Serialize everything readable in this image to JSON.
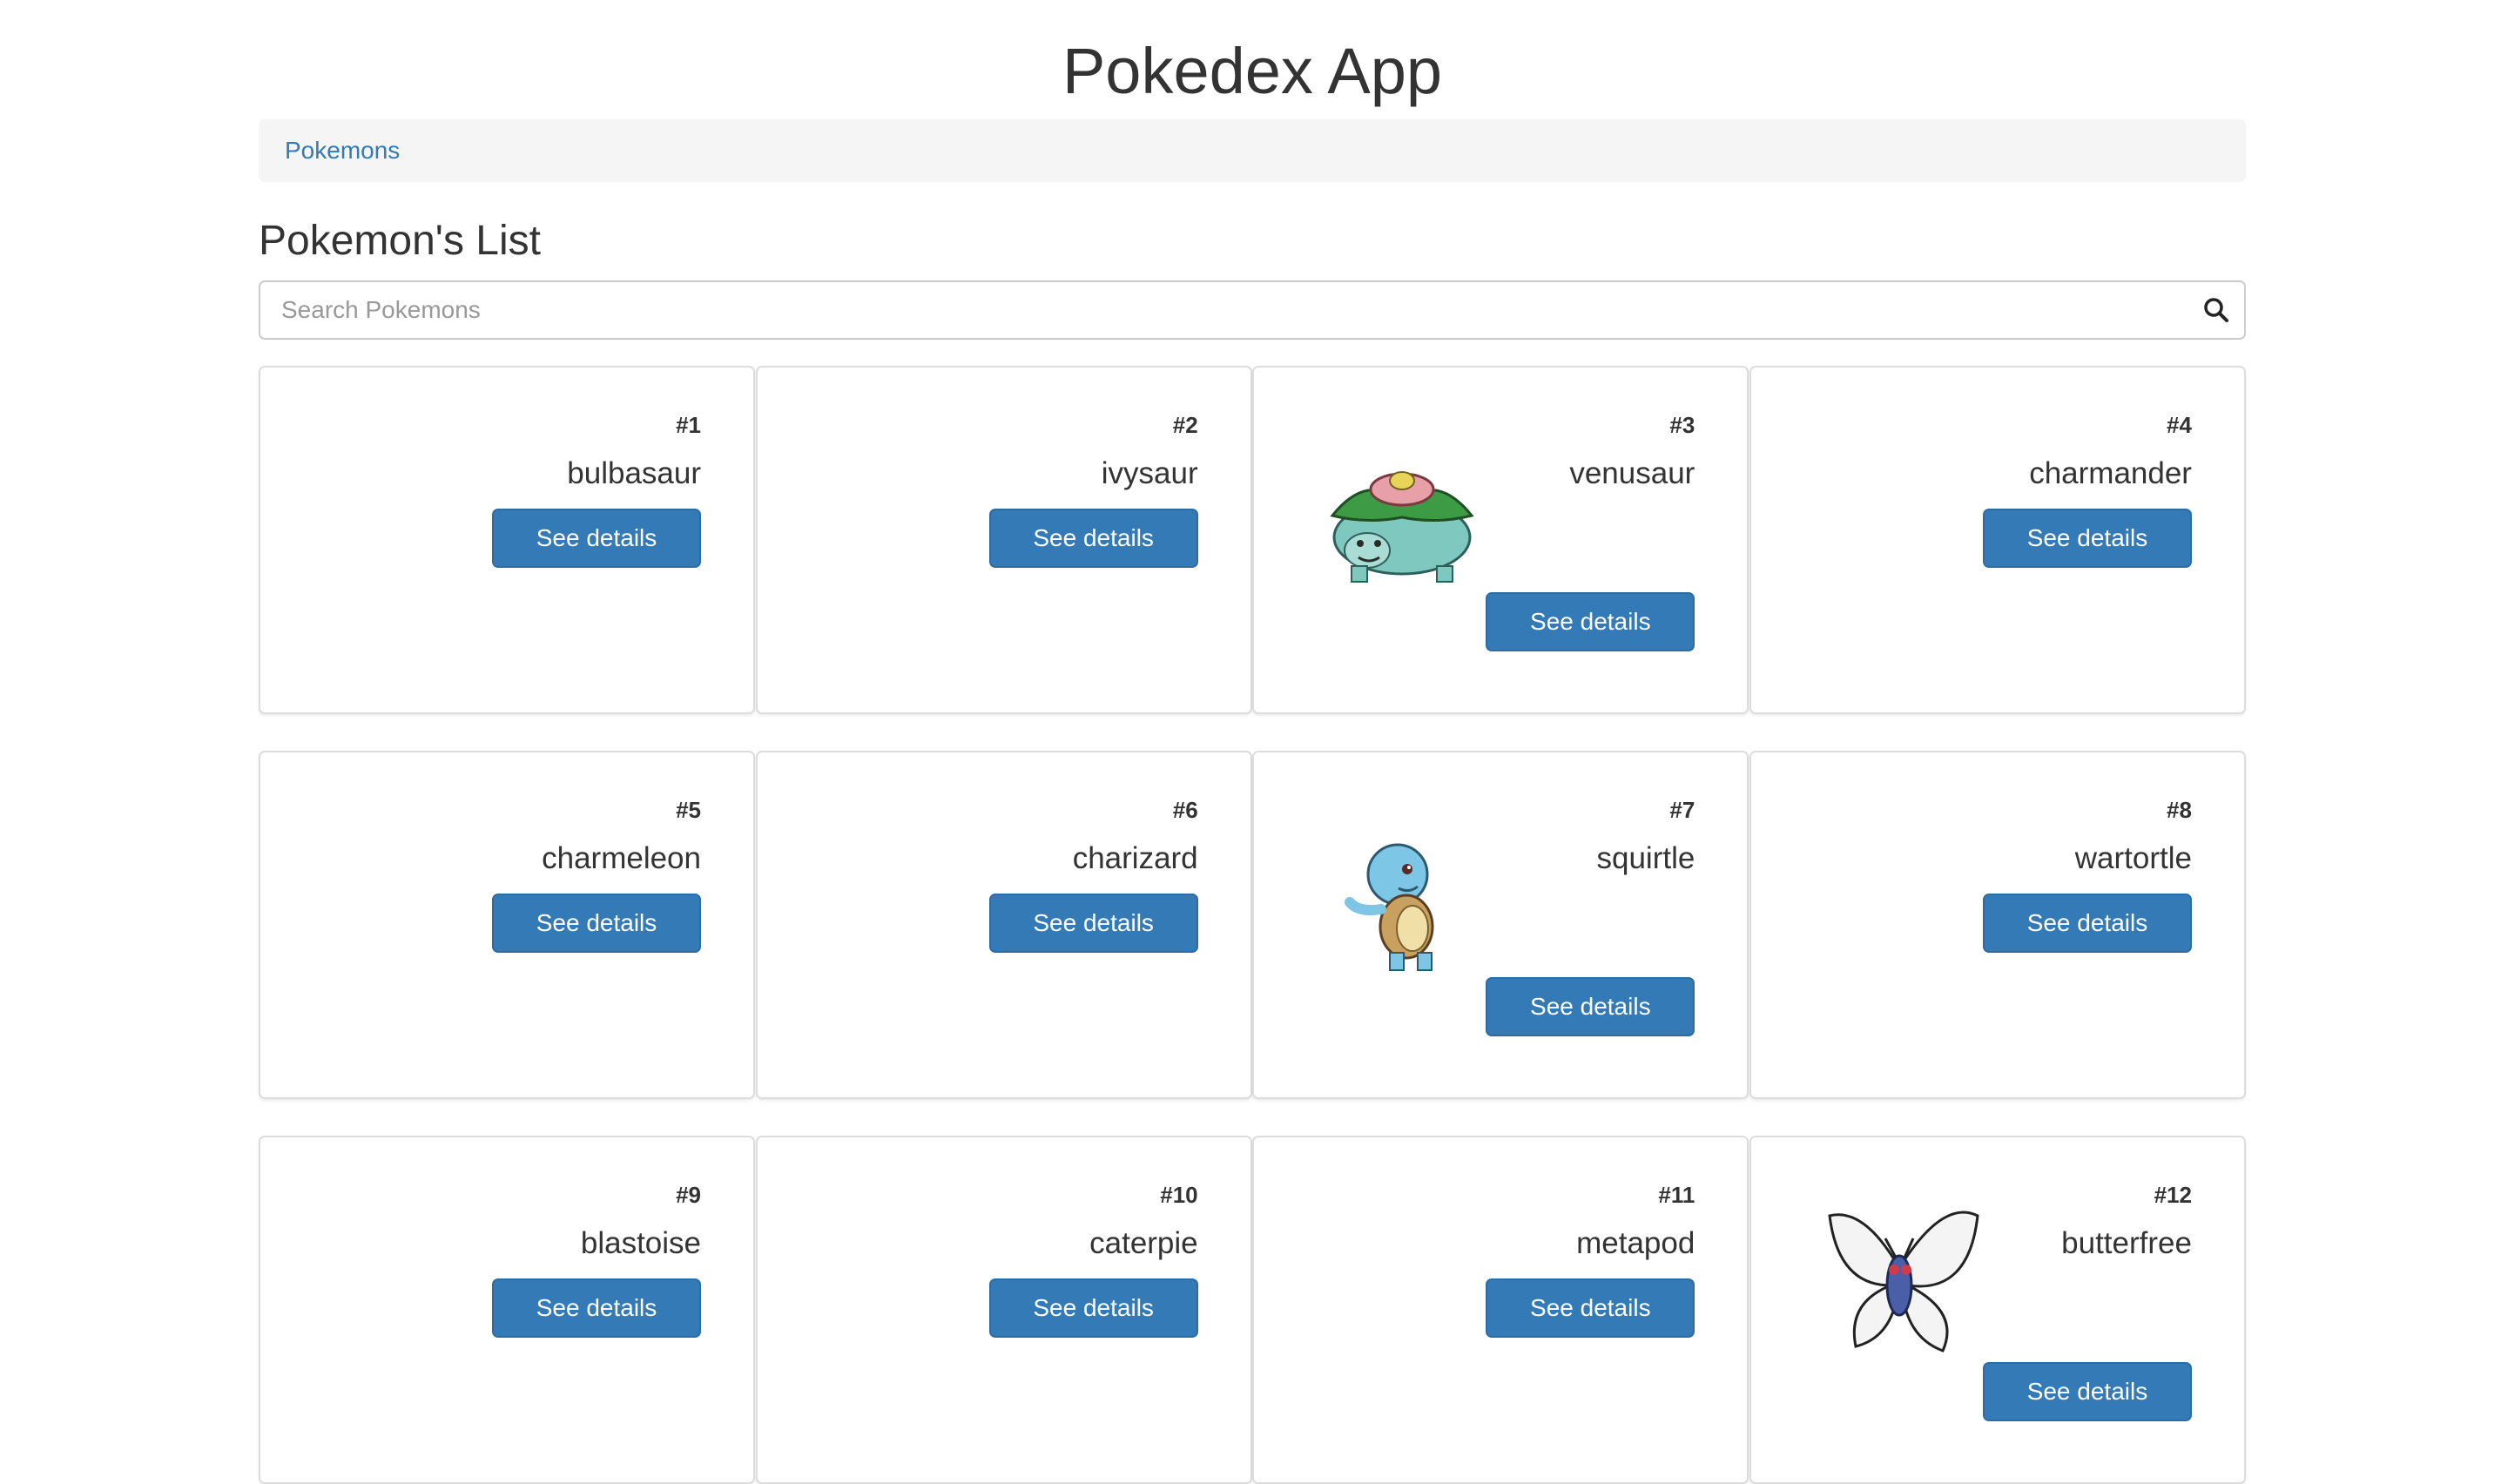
{
  "app": {
    "title": "Pokedex App"
  },
  "breadcrumb": {
    "item": "Pokemons"
  },
  "list": {
    "title": "Pokemon's List"
  },
  "search": {
    "placeholder": "Search Pokemons",
    "value": ""
  },
  "button_label": "See details",
  "pokemons": [
    {
      "id": "#1",
      "name": "bulbasaur",
      "sprite": ""
    },
    {
      "id": "#2",
      "name": "ivysaur",
      "sprite": ""
    },
    {
      "id": "#3",
      "name": "venusaur",
      "sprite": "venusaur-sprite"
    },
    {
      "id": "#4",
      "name": "charmander",
      "sprite": ""
    },
    {
      "id": "#5",
      "name": "charmeleon",
      "sprite": ""
    },
    {
      "id": "#6",
      "name": "charizard",
      "sprite": ""
    },
    {
      "id": "#7",
      "name": "squirtle",
      "sprite": "squirtle-sprite"
    },
    {
      "id": "#8",
      "name": "wartortle",
      "sprite": ""
    },
    {
      "id": "#9",
      "name": "blastoise",
      "sprite": ""
    },
    {
      "id": "#10",
      "name": "caterpie",
      "sprite": ""
    },
    {
      "id": "#11",
      "name": "metapod",
      "sprite": ""
    },
    {
      "id": "#12",
      "name": "butterfree",
      "sprite": "butterfree-sprite"
    }
  ],
  "colors": {
    "primary": "#337ab7",
    "primary_border": "#2e6da4",
    "link": "#337ab7"
  }
}
